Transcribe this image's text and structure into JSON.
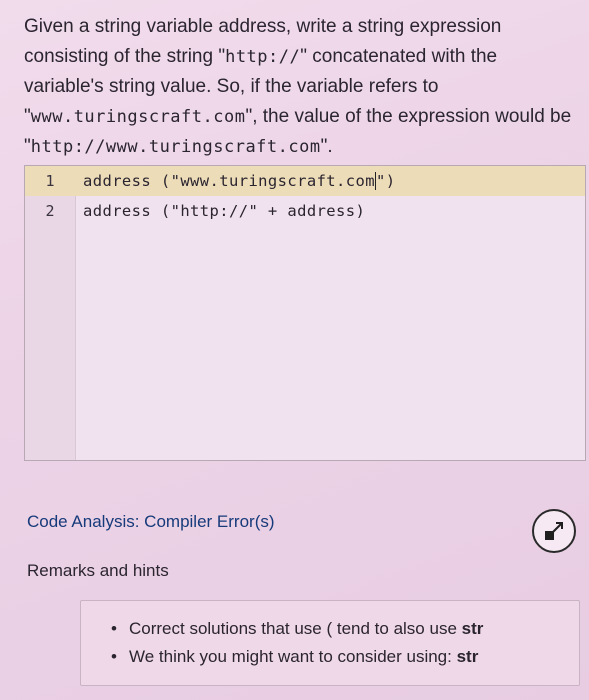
{
  "problem": {
    "part1": "Given a string variable address, write a string expression consisting of the string \"",
    "code1": "http://",
    "part2": "\" concatenated with the variable's string value. So, if the variable refers to \"",
    "code2": "www.turingscraft.com",
    "part3": "\", the value of the expression would be \"",
    "code3": "http://www.turingscraft.com",
    "part4": "\"."
  },
  "editor": {
    "lines": [
      {
        "number": "1",
        "code_before_cursor": "address (\"www.turingscraft.com",
        "code_after_cursor": "\")"
      },
      {
        "number": "2",
        "code": "address (\"http://\" + address)"
      }
    ]
  },
  "analysis": {
    "label": "Code Analysis: Compiler Error(s)"
  },
  "remarks": {
    "title": "Remarks and hints",
    "hints": [
      {
        "text": "Correct solutions that use ( tend to also use ",
        "strong": "str"
      },
      {
        "text": "We think you might want to consider using: ",
        "strong": "str"
      }
    ]
  },
  "colors": {
    "link": "#163a7a",
    "active_line": "#ecdcb8"
  },
  "icons": {
    "expand": "expand-arrow-icon"
  }
}
